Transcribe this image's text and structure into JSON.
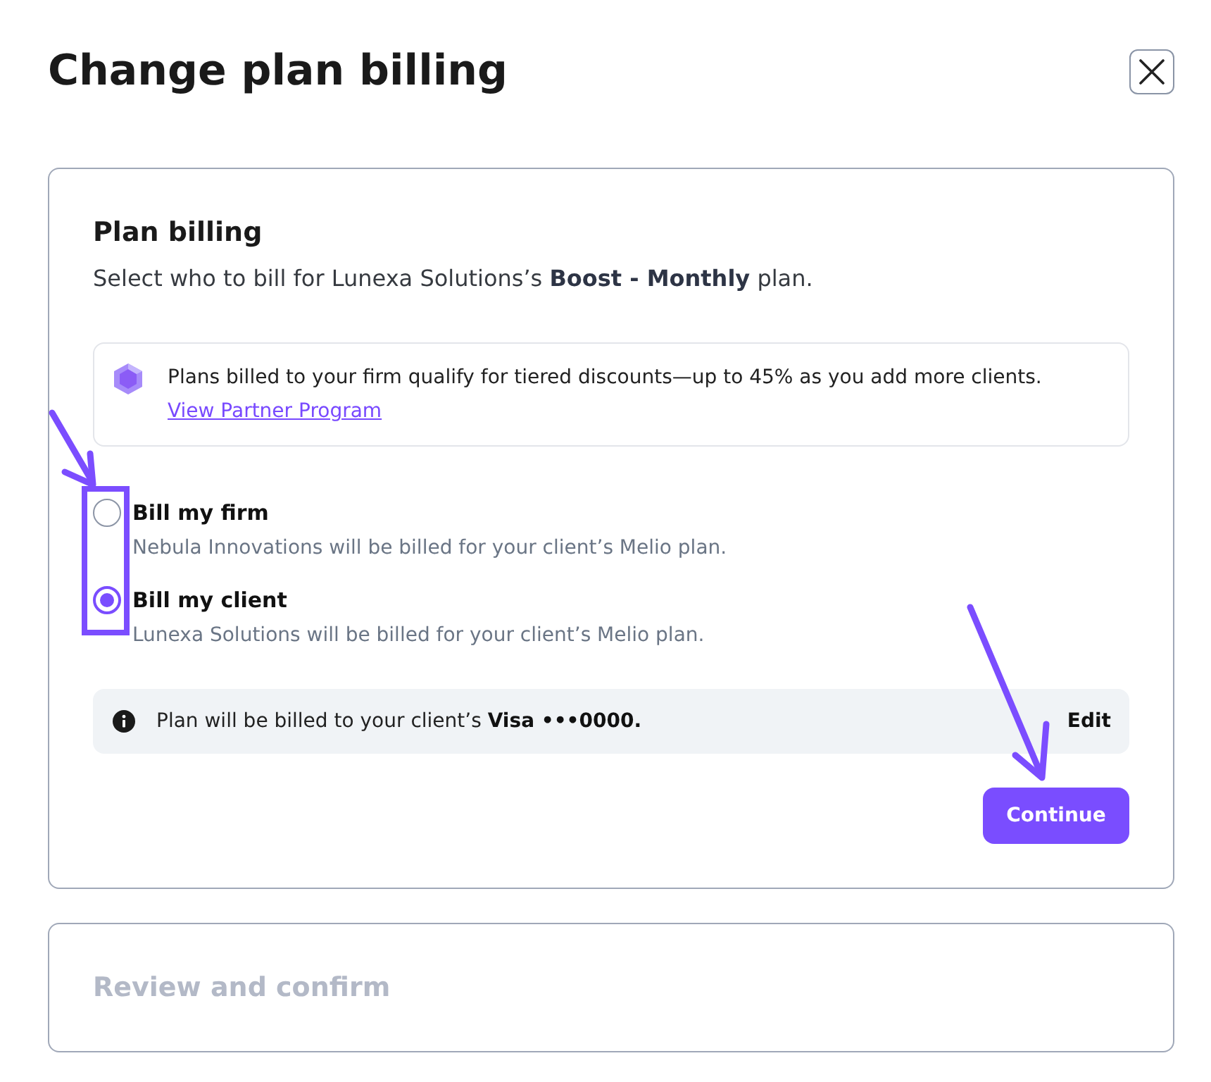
{
  "header": {
    "title": "Change plan billing"
  },
  "plan_billing": {
    "title": "Plan billing",
    "description": "Select who to bill for Lunexa Solutions’s **Boost - Monthly** plan.",
    "promo": {
      "text": "Plans billed to your firm qualify for tiered discounts—up to 45% as you add more clients.",
      "link": "View Partner Program"
    },
    "options": [
      {
        "label": "Bill my firm",
        "description": "Nebula Innovations will be billed for your client’s Melio plan.",
        "selected": false
      },
      {
        "label": "Bill my client",
        "description": "Lunexa Solutions will be billed for your client’s Melio plan.",
        "selected": true
      }
    ],
    "payment_notice": {
      "text": "Plan will be billed to your client’s **Visa •••0000.**",
      "action": "Edit"
    },
    "continue_button": "Continue"
  },
  "review_step": {
    "title": "Review and confirm",
    "disabled": true
  }
}
